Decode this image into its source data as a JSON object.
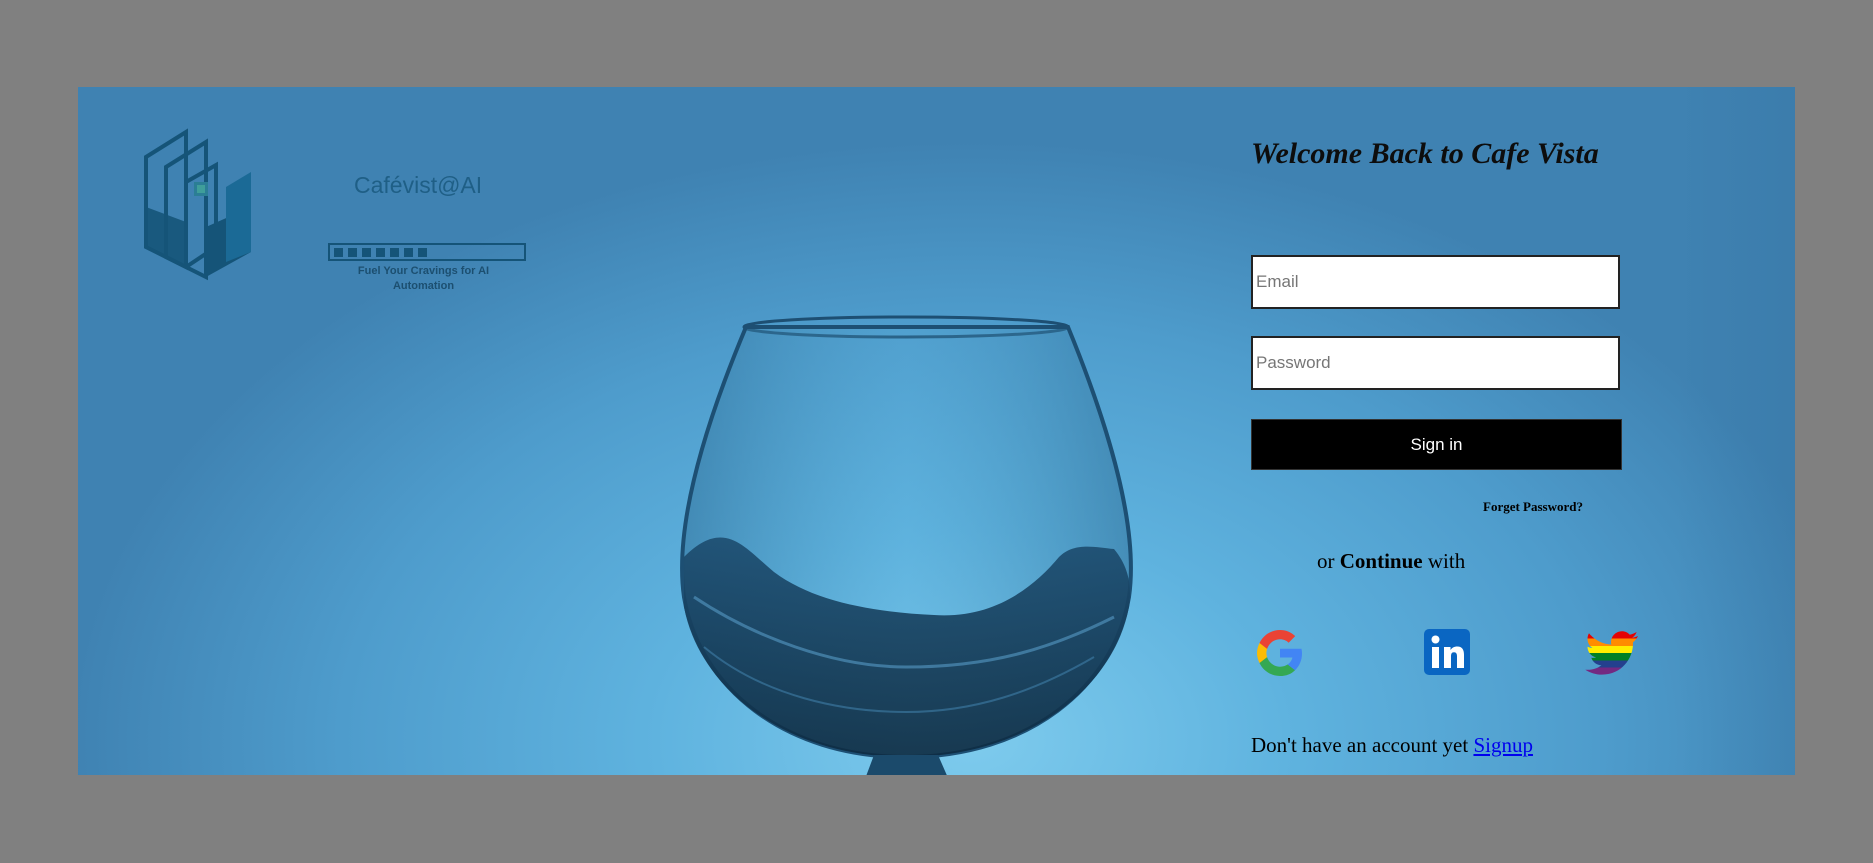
{
  "brand": {
    "name": "Cafévist@AI",
    "tagline_line1": "Fuel Your Cravings for AI",
    "tagline_line2": "Automation",
    "logo_icon": "pixel-maze-logo"
  },
  "login": {
    "title": "Welcome Back to Cafe Vista",
    "email_placeholder": "Email",
    "password_placeholder": "Password",
    "signin_label": "Sign in",
    "forgot_label": "Forget Password?",
    "or_prefix": "or",
    "or_bold": "Continue",
    "or_suffix": "with",
    "social": [
      {
        "icon": "google-icon",
        "label": "Google"
      },
      {
        "icon": "linkedin-icon",
        "label": "LinkedIn"
      },
      {
        "icon": "twitter-icon",
        "label": "Twitter"
      }
    ],
    "signup_prefix": "Don't have an account yet",
    "signup_link": "Signup"
  },
  "colors": {
    "backdrop": "#808080",
    "background_blue": "#5fb3df",
    "button_black": "#000000",
    "link_blue": "#0000ee"
  }
}
